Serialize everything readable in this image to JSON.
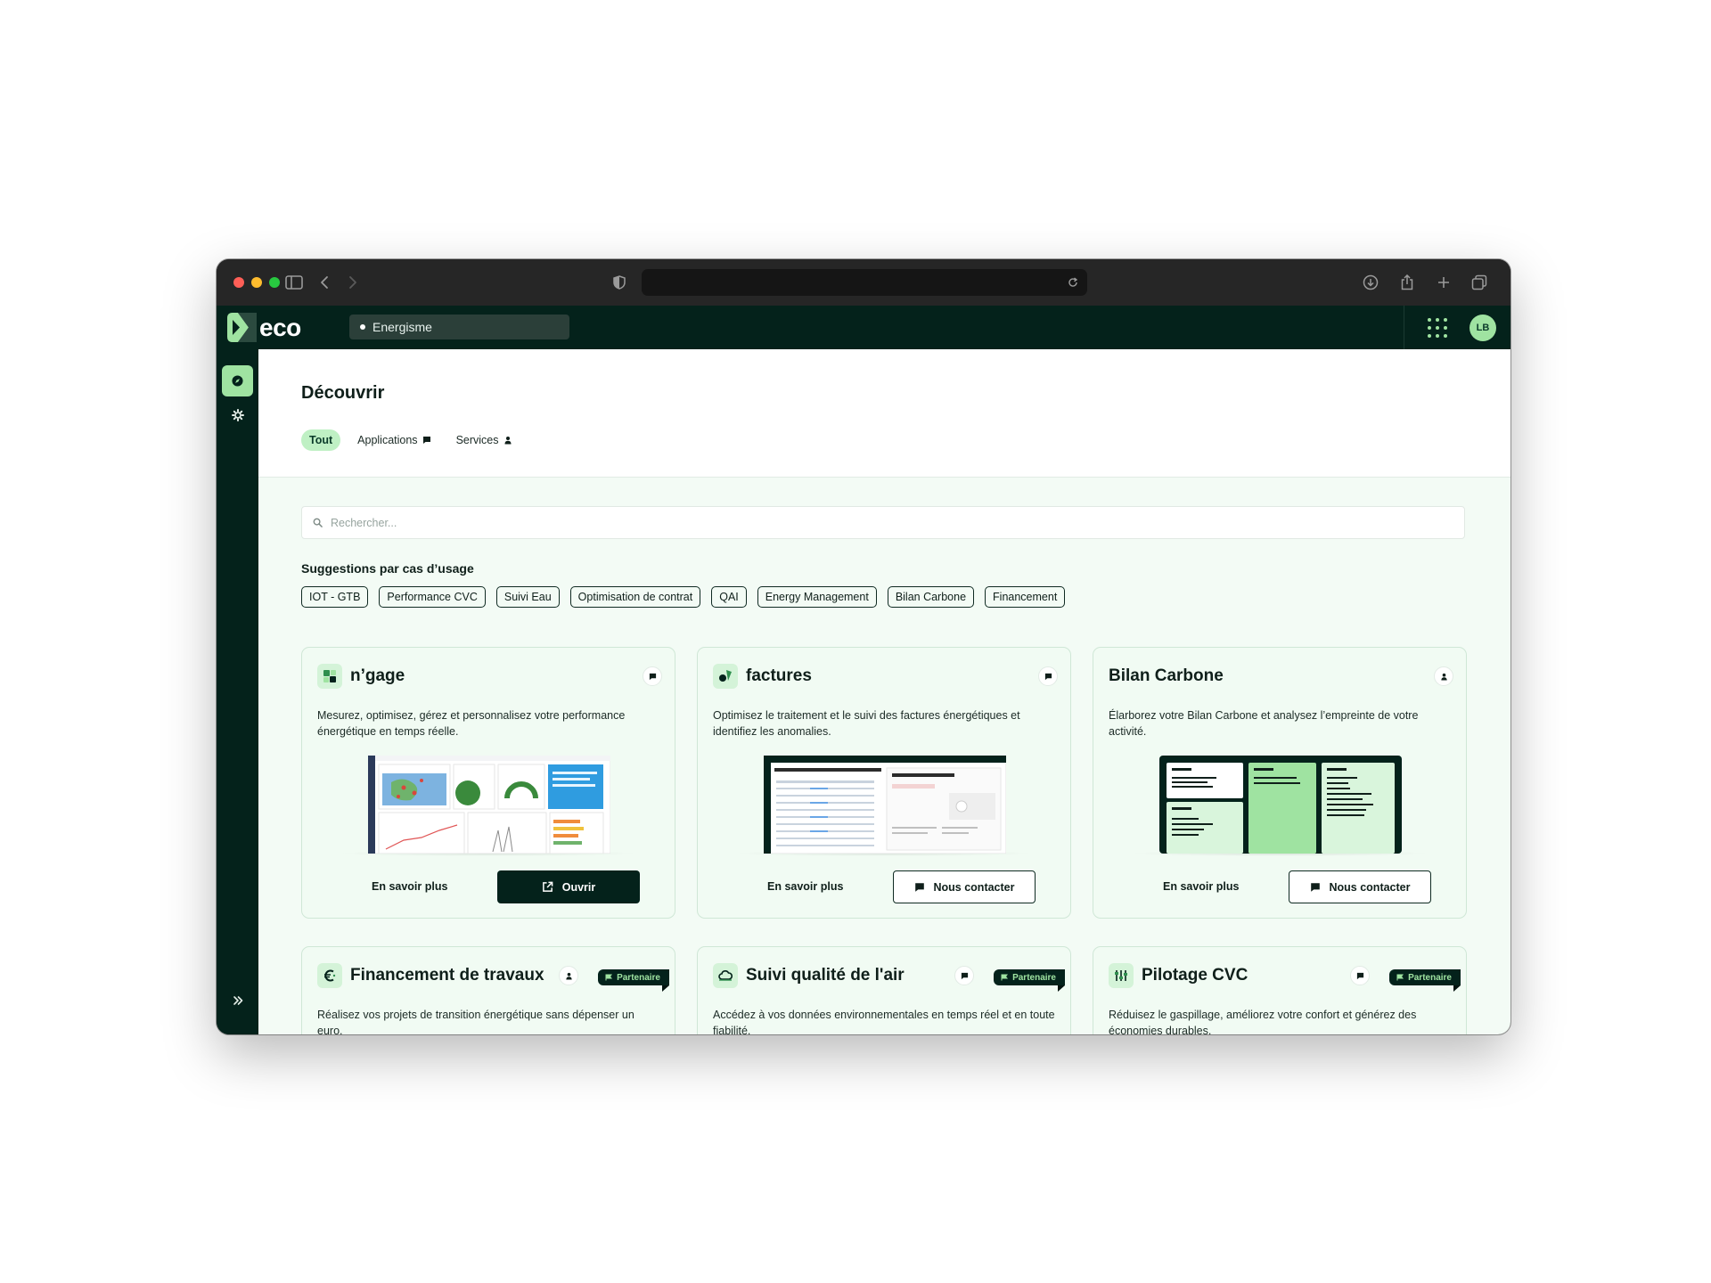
{
  "app": {
    "logo_text": "eco",
    "org_selector": "Energisme",
    "avatar_initials": "LB"
  },
  "page": {
    "title": "Découvrir",
    "tabs": [
      {
        "label": "Tout",
        "icon": "none",
        "active": true
      },
      {
        "label": "Applications",
        "icon": "chat-icon",
        "active": false
      },
      {
        "label": "Services",
        "icon": "person-icon",
        "active": false
      }
    ]
  },
  "search": {
    "placeholder": "Rechercher...",
    "value": ""
  },
  "suggestions": {
    "title": "Suggestions par cas d’usage",
    "chips": [
      "IOT - GTB",
      "Performance CVC",
      "Suivi Eau",
      "Optimisation de contrat",
      "QAI",
      "Energy Management",
      "Bilan Carbone",
      "Financement"
    ]
  },
  "cards": [
    {
      "title": "n’gage",
      "type_icon": "chat-icon",
      "description": "Mesurez, optimisez, gérez et personnalisez votre performance énergétique en temps réelle.",
      "secondary_label": "En savoir plus",
      "primary_label": "Ouvrir",
      "primary_icon": "external-link-icon"
    },
    {
      "title": "factures",
      "type_icon": "chat-icon",
      "description": "Optimisez le traitement et le suivi des factures énergétiques et identifiez les anomalies.",
      "secondary_label": "En savoir plus",
      "primary_label": "Nous contacter",
      "primary_icon": "chat-icon"
    },
    {
      "title": "Bilan Carbone",
      "type_icon": "person-icon",
      "description": "Élarborez votre Bilan Carbone et analysez l’empreinte de votre activité.",
      "secondary_label": "En savoir plus",
      "primary_label": "Nous contacter",
      "primary_icon": "chat-icon"
    },
    {
      "title": "Financement de travaux",
      "type_icon": "person-icon",
      "badge": "Partenaire",
      "description": "Réalisez vos projets de transition énergétique sans dépenser un euro."
    },
    {
      "title": "Suivi qualité de l'air",
      "type_icon": "chat-icon",
      "badge": "Partenaire",
      "description": "Accédez à vos données environnementales en temps réel et en toute fiabilité."
    },
    {
      "title": "Pilotage CVC",
      "type_icon": "chat-icon",
      "badge": "Partenaire",
      "description": "Réduisez le gaspillage, améliorez votre confort et générez des économies durables."
    }
  ],
  "colors": {
    "brand_dark": "#04221b",
    "accent_green": "#9fe3a1",
    "content_bg": "#f3fbf5"
  }
}
